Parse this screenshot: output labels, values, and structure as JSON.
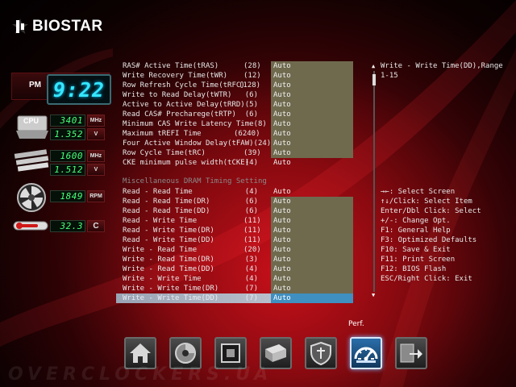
{
  "brand": {
    "name": "BIOSTAR"
  },
  "status": {
    "ampm": "PM",
    "time": "9:22",
    "cpu_label": "CPU",
    "cpu_freq": "3401",
    "cpu_freq_unit": "MHz",
    "cpu_volt": "1.352",
    "cpu_volt_unit": "V",
    "mem_freq": "1600",
    "mem_freq_unit": "MHz",
    "mem_volt": "1.512",
    "mem_volt_unit": "V",
    "fan_rpm": "1849",
    "fan_unit": "RPM",
    "temperature": "32.3",
    "temp_unit": "C"
  },
  "timings": [
    {
      "label": "RAS# Active Time(tRAS)",
      "value": "(28)",
      "setting": "Auto"
    },
    {
      "label": "Write Recovery Time(tWR)",
      "value": "(12)",
      "setting": "Auto"
    },
    {
      "label": "Row Refresh Cycle Time(tRFC)",
      "value": "(128)",
      "setting": "Auto"
    },
    {
      "label": "Write to Read Delay(tWTR)",
      "value": "(6)",
      "setting": "Auto"
    },
    {
      "label": "Active to Active Delay(tRRD)",
      "value": "(5)",
      "setting": "Auto"
    },
    {
      "label": "Read CAS# Precharege(tRTP)",
      "value": "(6)",
      "setting": "Auto"
    },
    {
      "label": "Minimum CAS Write Latency Time(8)",
      "value": "",
      "setting": "Auto"
    },
    {
      "label": "Maximum tREFI Time",
      "value": "(6240)",
      "setting": "Auto"
    },
    {
      "label": "Four Active Window Delay(tFAW)(24)",
      "value": "",
      "setting": "Auto"
    },
    {
      "label": "Row Cycle Time(tRC)",
      "value": "(39)",
      "setting": "Auto"
    },
    {
      "label": "CKE minimum pulse width(tCKE)",
      "value": "(4)",
      "setting": "Auto"
    }
  ],
  "misc_section": {
    "title": "Miscellaneous DRAM Timing Setting"
  },
  "misc_timings": [
    {
      "label": "Read - Read Time",
      "value": "(4)",
      "setting": "Auto"
    },
    {
      "label": "Read - Read Time(DR)",
      "value": "(6)",
      "setting": "Auto"
    },
    {
      "label": "Read - Read Time(DD)",
      "value": "(6)",
      "setting": "Auto"
    },
    {
      "label": "Read - Write Time",
      "value": "(11)",
      "setting": "Auto"
    },
    {
      "label": "Read - Write Time(DR)",
      "value": "(11)",
      "setting": "Auto"
    },
    {
      "label": "Read - Write Time(DD)",
      "value": "(11)",
      "setting": "Auto"
    },
    {
      "label": "Write - Read Time",
      "value": "(20)",
      "setting": "Auto"
    },
    {
      "label": "Write - Read Time(DR)",
      "value": "(3)",
      "setting": "Auto"
    },
    {
      "label": "Write - Read Time(DD)",
      "value": "(4)",
      "setting": "Auto"
    },
    {
      "label": "Write - Write Time",
      "value": "(4)",
      "setting": "Auto"
    },
    {
      "label": "Write - Write Time(DR)",
      "value": "(7)",
      "setting": "Auto"
    },
    {
      "label": "Write - Write Time(DD)",
      "value": "(7)",
      "setting": "Auto"
    }
  ],
  "help": {
    "line1": "Write - Write Time(DD),Range",
    "line2": "1-15"
  },
  "keys": [
    "→←: Select Screen",
    "↑↓/Click: Select Item",
    "Enter/Dbl Click: Select",
    "+/-: Change Opt.",
    "F1: General Help",
    "F3: Optimized Defaults",
    "F10: Save & Exit",
    "F11: Print Screen",
    "F12: BIOS Flash",
    "ESC/Right Click: Exit"
  ],
  "nav": {
    "active_label": "Perf.",
    "items": [
      "home-icon",
      "disc-icon",
      "chip-icon",
      "drive-icon",
      "shield-icon",
      "performance-icon",
      "exit-icon"
    ]
  },
  "colors": {
    "field_bg": "#6f6a4e",
    "selected_field": "#3f8fc0",
    "lcd_green": "#4aff7a",
    "clock_cyan": "#36e6ff"
  }
}
